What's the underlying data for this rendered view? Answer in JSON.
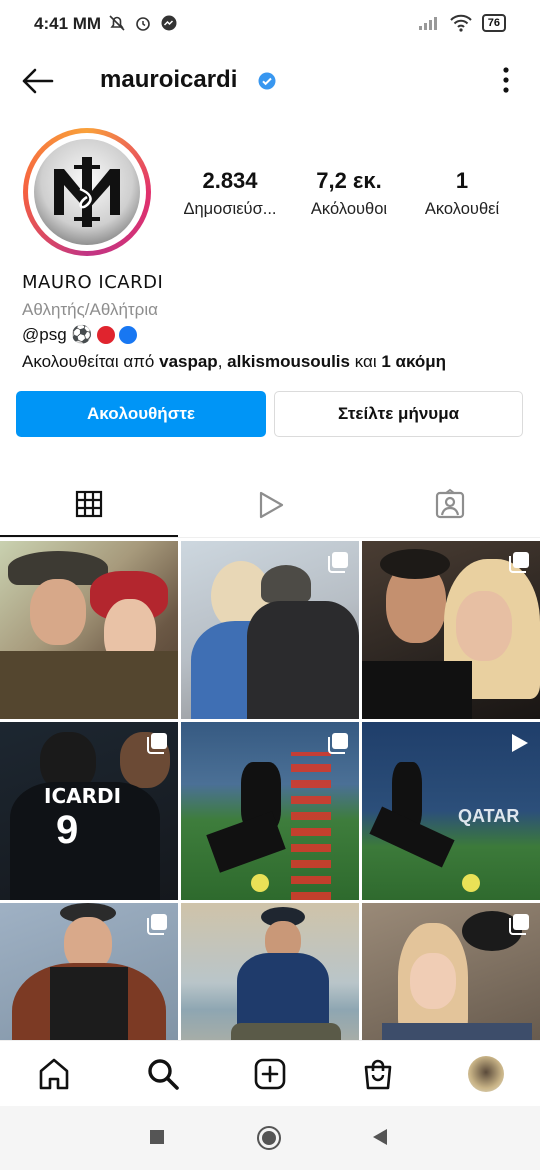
{
  "status_bar": {
    "time": "4:41 MM",
    "battery": "76"
  },
  "header": {
    "username": "mauroicardi"
  },
  "profile": {
    "stats": [
      {
        "value": "2.834",
        "label": "Δημοσιεύσ..."
      },
      {
        "value": "7,2 εκ.",
        "label": "Ακόλουθοι"
      },
      {
        "value": "1",
        "label": "Ακολουθεί"
      }
    ],
    "full_name": "MAURO ICARDI",
    "category": "Αθλητής/Αθλήτρια",
    "bio_text": "@psg ⚽",
    "followed_by_prefix": "Ακολουθείται από ",
    "followed_by_user1": "vaspap",
    "followed_by_sep": ", ",
    "followed_by_user2": "alkismousoulis",
    "followed_by_and": " και ",
    "followed_by_more": "1 ακόμη"
  },
  "buttons": {
    "follow": "Ακολουθήστε",
    "message": "Στείλτε μήνυμα"
  },
  "grid": {
    "tiles": [
      {
        "caption": "",
        "type": "photo"
      },
      {
        "caption": "",
        "type": "carousel"
      },
      {
        "caption": "",
        "type": "carousel"
      },
      {
        "caption": "ICARDI",
        "type": "carousel"
      },
      {
        "caption": "",
        "type": "carousel"
      },
      {
        "caption": "QATAR",
        "type": "reel"
      },
      {
        "caption": "",
        "type": "carousel"
      },
      {
        "caption": "",
        "type": "photo"
      },
      {
        "caption": "",
        "type": "carousel"
      }
    ]
  },
  "colors": {
    "accent": "#0095f6",
    "verified": "#3897f0",
    "red_dot": "#e0242e",
    "blue_dot": "#1877f2"
  }
}
